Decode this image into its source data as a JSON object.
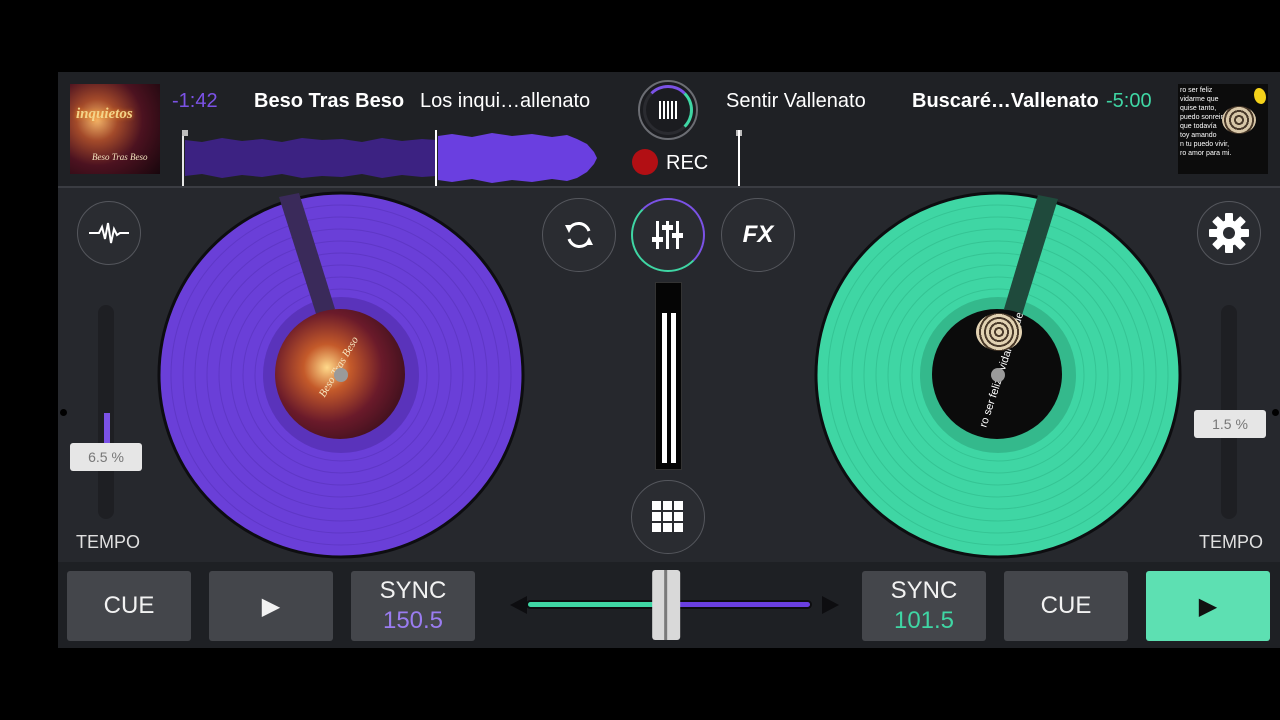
{
  "deck_a": {
    "cover_title": "inquietos",
    "cover_subtitle": "Beso Tras Beso",
    "time_remaining": "-1:42",
    "title": "Beso Tras Beso",
    "artist": "Los inqui…allenato",
    "label_text": "Beso Tras Beso",
    "tempo_value": "6.5 %",
    "tempo_label": "TEMPO",
    "tempo_level": 0.065,
    "cue_label": "CUE",
    "sync_label": "SYNC",
    "bpm": "150.5",
    "color": "#7b52e6"
  },
  "deck_b": {
    "cover_lines": [
      "ro ser feliz",
      "vidarme que",
      "quise tanto,",
      "puedo sonreir,",
      "que todavía",
      "toy amando",
      "n tu puedo vivir,",
      "ro amor para mi."
    ],
    "label_text": "ro ser feliz / vidarme que / uise tanto, / puedo sonreir, / ue todavía / toy amando / tu puedo vivir, / ro amor para mi.",
    "artist": "Sentir Vallenato",
    "title": "Buscaré…Vallenato",
    "time_remaining": "-5:00",
    "tempo_value": "1.5 %",
    "tempo_label": "TEMPO",
    "tempo_level": 0.015,
    "cue_label": "CUE",
    "sync_label": "SYNC",
    "bpm": "101.5",
    "color": "#3fd6a4"
  },
  "center": {
    "rec_label": "REC",
    "fx_label": "FX",
    "crossfader_position": 0.49
  },
  "icons": {
    "play": "▶",
    "left_arrow": "◀",
    "right_arrow": "▶"
  },
  "colors": {
    "deck_a": "#7b52e6",
    "deck_b": "#3fd6a4",
    "rec": "#b20f14",
    "background": "#26282d"
  }
}
